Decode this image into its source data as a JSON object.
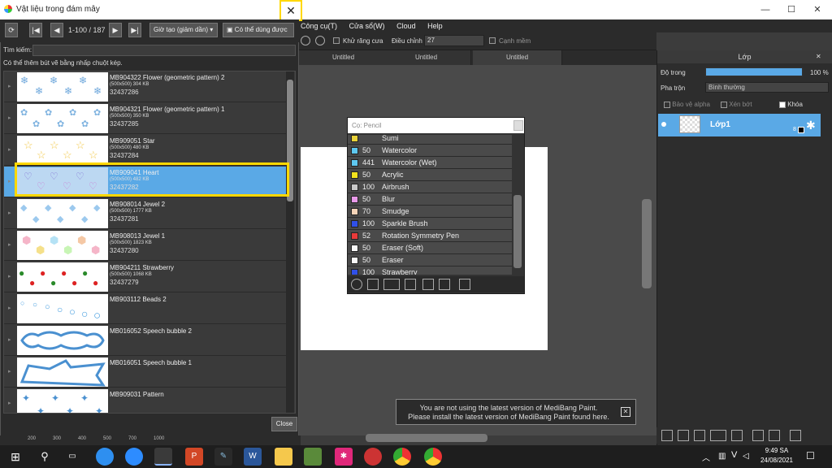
{
  "app": {
    "window_controls": {
      "minimize": "—",
      "maximize": "☐",
      "close": "✕"
    },
    "menu": [
      "Công cụ(T)",
      "Cửa sổ(W)",
      "Cloud",
      "Help"
    ],
    "toolbar": {
      "antialias_label": "Khử răng cưa",
      "adjust_label": "Điều chỉnh",
      "adjust_value": "27",
      "soften_label": "Cạnh mềm"
    },
    "doc_tabs": [
      "Untitled",
      "Untitled",
      "Untitled"
    ]
  },
  "layer_panel": {
    "title": "Lớp",
    "opacity_label": "Độ trong",
    "opacity_value": "100 %",
    "opacity_fraction": 1.0,
    "blend_label": "Pha trộn",
    "blend_value": "Bình thường",
    "protect_alpha": "Bảo vệ alpha",
    "clipping": "Xén bớt",
    "lock": "Khóa",
    "layer_name": "Lớp1",
    "layer_number": "8"
  },
  "brush_panel": {
    "title": "Cọ: Pencil",
    "items": [
      {
        "size": "",
        "name": "Sumi",
        "color": "#e8d23a"
      },
      {
        "size": "50",
        "name": "Watercolor",
        "color": "#5ec8f0"
      },
      {
        "size": "441",
        "name": "Watercolor (Wet)",
        "color": "#5ec8f0"
      },
      {
        "size": "50",
        "name": "Acrylic",
        "color": "#f2e21d"
      },
      {
        "size": "100",
        "name": "Airbrush",
        "color": "#c8c8c8"
      },
      {
        "size": "50",
        "name": "Blur",
        "color": "#e89ae8"
      },
      {
        "size": "70",
        "name": "Smudge",
        "color": "#f5d4b8"
      },
      {
        "size": "100",
        "name": "Sparkle Brush",
        "color": "#3050e8"
      },
      {
        "size": "52",
        "name": "Rotation Symmetry Pen",
        "color": "#e83a3a"
      },
      {
        "size": "50",
        "name": "Eraser (Soft)",
        "color": "#f8f8f8"
      },
      {
        "size": "50",
        "name": "Eraser",
        "color": "#f8f8f8"
      },
      {
        "size": "100",
        "name": "Strawberry",
        "color": "#3050e8"
      }
    ]
  },
  "cloud": {
    "title": "Vật liệu trong đám mây",
    "close_x": "✕",
    "page_info": "1-100 / 187",
    "sort": "Giờ tạo (giảm dần)",
    "usable": "Có thể dùng được",
    "search_label": "Tìm kiếm:",
    "search_value": "",
    "hint": "Có thể thêm bút vẽ bằng nhấp chuột kép.",
    "close_button": "Close",
    "materials": [
      {
        "name": "MB904322 Flower (geometric pattern) 2",
        "meta": "(500x500) 304 KB",
        "id": "32437286",
        "selected": false
      },
      {
        "name": "MB904321 Flower (geometric pattern) 1",
        "meta": "(500x500) 350 KB",
        "id": "32437285",
        "selected": false
      },
      {
        "name": "MB909051 Star",
        "meta": "(500x500) 480 KB",
        "id": "32437284",
        "selected": false
      },
      {
        "name": "MB909041 Heart",
        "meta": "(500x500) 482 KB",
        "id": "32437282",
        "selected": true
      },
      {
        "name": "MB908014 Jewel 2",
        "meta": "(500x500) 1777 KB",
        "id": "32437281",
        "selected": false
      },
      {
        "name": "MB908013 Jewel 1",
        "meta": "(500x500) 1823 KB",
        "id": "32437280",
        "selected": false
      },
      {
        "name": "MB904211 Strawberry",
        "meta": "(500x500) 1068 KB",
        "id": "32437279",
        "selected": false
      },
      {
        "name": "MB903112 Beads 2",
        "meta": "",
        "id": "",
        "selected": false
      },
      {
        "name": "MB016052 Speech bubble 2",
        "meta": "",
        "id": "",
        "selected": false
      },
      {
        "name": "MB016051 Speech bubble 1",
        "meta": "",
        "id": "",
        "selected": false
      },
      {
        "name": "MB909031 Pattern",
        "meta": "",
        "id": "",
        "selected": false
      }
    ],
    "ruler_ticks": [
      "200",
      "300",
      "400",
      "500",
      "700",
      "1000"
    ]
  },
  "notification": {
    "line1": "You are not using the latest version of MediBang Paint.",
    "line2": "Please install the latest version of MediBang Paint found here."
  },
  "taskbar": {
    "time": "9:49 SA",
    "date": "24/08/2021",
    "lang": "V"
  }
}
